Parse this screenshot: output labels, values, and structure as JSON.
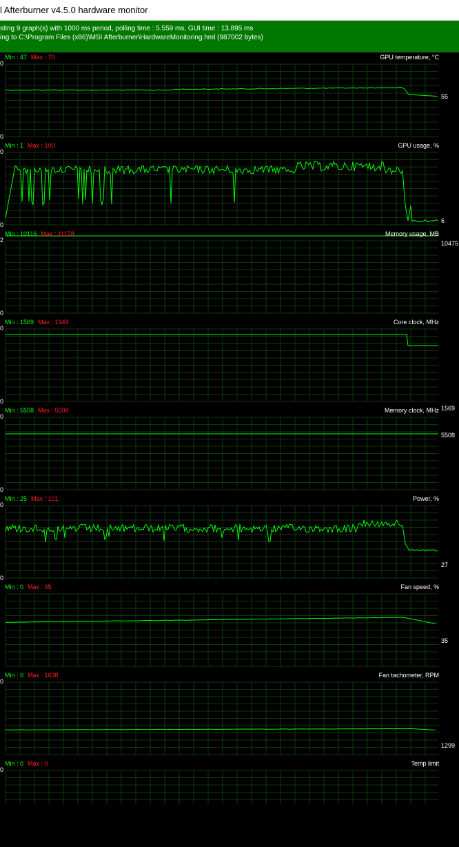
{
  "window": {
    "title": "l Afterburner v4.5.0 hardware monitor"
  },
  "status": {
    "line1": "sting 9 graph(s) with 1000 ms period, polling time : 5.559 ms, GUI time : 13.895 ms",
    "line2": "ing to C:\\Program Files (x86)\\MSI Afterburner\\HardwareMonitoring.hml (987002 bytes)"
  },
  "colors": {
    "status_bg": "#007800",
    "graph_line": "#00ff00",
    "grid": "#0c3a0c",
    "max_text": "#ff2020"
  },
  "graphs": [
    {
      "name": "GPU temperature, °C",
      "min": "Min : 47",
      "max": "Max : 70",
      "current": "55",
      "ymax": "0",
      "ymin": "0"
    },
    {
      "name": "GPU usage, %",
      "min": "Min : 1",
      "max": "Max : 100",
      "current": "6",
      "ymax": "0",
      "ymin": "0"
    },
    {
      "name": "Memory usage, MB",
      "min": "Min : 10116",
      "max": "Max : 11178",
      "current": "10475",
      "ymax": "2",
      "ymin": "0"
    },
    {
      "name": "Core clock, MHz",
      "min": "Min : 1569",
      "max": "Max : 1949",
      "current": "1569",
      "ymax": "0",
      "ymin": "0"
    },
    {
      "name": "Memory clock, MHz",
      "min": "Min : 5508",
      "max": "Max : 5508",
      "current": "5508",
      "ymax": "0",
      "ymin": "0"
    },
    {
      "name": "Power, %",
      "min": "Min : 25",
      "max": "Max : 101",
      "current": "27",
      "ymax": "0",
      "ymin": "0"
    },
    {
      "name": "Fan speed, %",
      "min": "Min : 0",
      "max": "Max : 45",
      "current": "35",
      "ymax": "",
      "ymin": ""
    },
    {
      "name": "Fan tachometer, RPM",
      "min": "Min : 0",
      "max": "Max : 1638",
      "current": "1299",
      "ymax": "0",
      "ymin": ""
    },
    {
      "name": "Temp limit",
      "min": "Min : 0",
      "max": "Max : 0",
      "current": "",
      "ymax": "0",
      "ymin": ""
    }
  ]
}
